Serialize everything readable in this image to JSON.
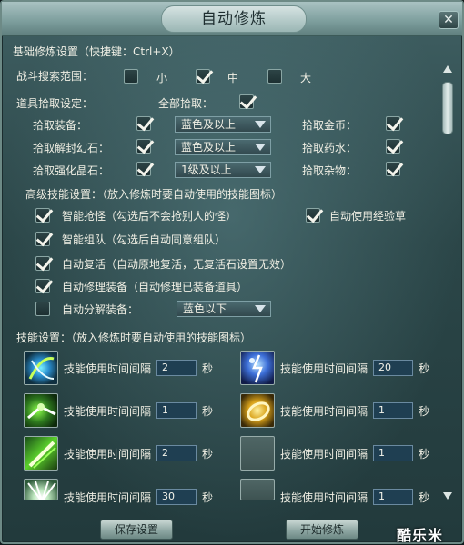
{
  "window": {
    "title": "自动修炼"
  },
  "basic": {
    "heading": "基础修炼设置（快捷键：Ctrl+X）",
    "search_range": {
      "label": "战斗搜索范围：",
      "options": [
        {
          "label": "小",
          "checked": false
        },
        {
          "label": "中",
          "checked": true
        },
        {
          "label": "大",
          "checked": false
        }
      ]
    },
    "pickup": {
      "label": "道具拾取设定：",
      "all_label": "全部拾取：",
      "all_checked": true,
      "rows": [
        {
          "label": "拾取装备：",
          "checked": true,
          "dropdown": "蓝色及以上",
          "right_label": "拾取金币：",
          "right_checked": true
        },
        {
          "label": "拾取解封幻石：",
          "checked": true,
          "dropdown": "蓝色及以上",
          "right_label": "拾取药水：",
          "right_checked": true
        },
        {
          "label": "拾取强化晶石：",
          "checked": true,
          "dropdown": "1级及以上",
          "right_label": "拾取杂物：",
          "right_checked": true
        }
      ]
    }
  },
  "advanced": {
    "heading": "高级技能设置：（放入修炼时要自动使用的技能图标）",
    "items": [
      {
        "label": "智能抢怪（勾选后不会抢别人的怪）",
        "checked": true
      },
      {
        "label": "智能组队（勾选后自动同意组队）",
        "checked": true
      },
      {
        "label": "自动复活（自动原地复活，无复活石设置无效）",
        "checked": true
      },
      {
        "label": "自动修理装备（自动修理已装备道具）",
        "checked": true
      },
      {
        "label": "自动分解装备：",
        "checked": false,
        "dropdown": "蓝色以下"
      }
    ],
    "exp_herb": {
      "label": "自动使用经验草",
      "checked": true
    }
  },
  "skills": {
    "heading": "技能设置：（放入修炼时要自动使用的技能图标）",
    "interval_label": "技能使用时间间隔",
    "unit": "秒",
    "left": [
      {
        "icon": "wind-blade-skill-icon",
        "value": "2"
      },
      {
        "icon": "claw-strike-skill-icon",
        "value": "1"
      },
      {
        "icon": "green-slash-skill-icon",
        "value": "2"
      },
      {
        "icon": "fan-spread-skill-icon",
        "value": "30"
      }
    ],
    "right": [
      {
        "icon": "lightning-warrior-skill-icon",
        "value": "20"
      },
      {
        "icon": "golden-ring-skill-icon",
        "value": "1"
      },
      {
        "icon": "empty-skill-slot",
        "value": "1"
      },
      {
        "icon": "empty-skill-slot",
        "value": "1"
      }
    ]
  },
  "footer": {
    "save_label": "保存设置",
    "start_label": "开始修炼",
    "watermark": "酷乐米"
  }
}
